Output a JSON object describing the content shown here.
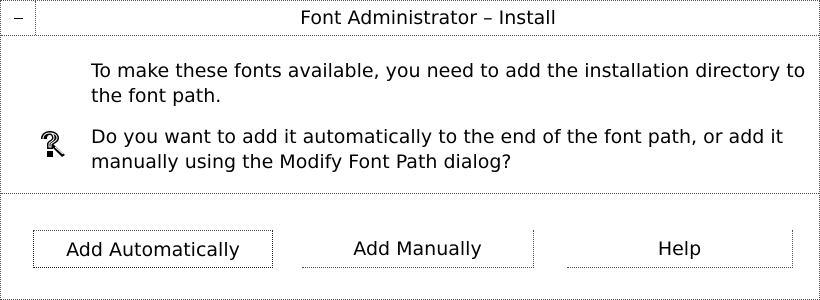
{
  "window": {
    "title": "Font Administrator – Install"
  },
  "message": {
    "icon": "question-icon",
    "paragraph1": "To make these fonts available, you need to add the installation directory to the font path.",
    "paragraph2": "Do you want to add it automatically to the end of the font path, or add it manually using the Modify Font Path dialog?"
  },
  "buttons": {
    "add_automatically": "Add Automatically",
    "add_manually": "Add Manually",
    "help": "Help"
  }
}
